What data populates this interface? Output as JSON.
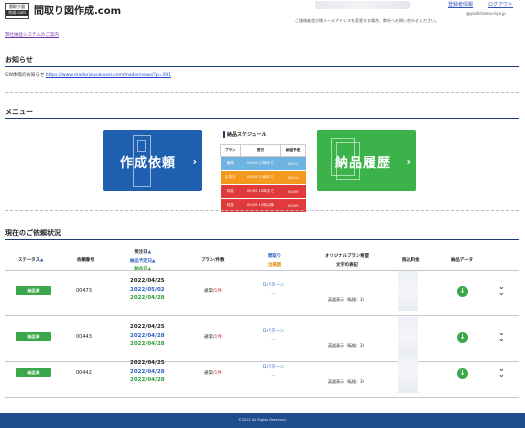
{
  "header": {
    "logo_line1": "間取り図",
    "logo_line2": "作成.com",
    "site_title": "間取り図作成.com",
    "link_register": "登録者情報",
    "link_logout": "ログアウト",
    "note_email": "@yoshihama-riya.jp",
    "note_change": "ご連絡者並び様メールアドレスを変更する場合、弊社へお問い合わせください。",
    "system_link": "弊社納品システムのご案内"
  },
  "news": {
    "title": "お知らせ",
    "text": "GW休暇のお知らせ",
    "link": "https://www.madorizusakusei.com/madorinews/?p=391"
  },
  "menu": {
    "title": "メニュー",
    "create_label": "作成依頼",
    "history_label": "納品履歴",
    "arrow": "›",
    "schedule": {
      "title": "納品スケジュール",
      "headers": [
        "プラン",
        "受付",
        "納品予定"
      ],
      "rows": [
        {
          "plan": "通常",
          "accept": "05/09 12時まで",
          "due": "05/12",
          "color": "#6fb3e0"
        },
        {
          "plan": "お急ぎ",
          "accept": "05/09 12時まで",
          "due": "05/10",
          "color": "#f39a1e"
        },
        {
          "plan": "特急",
          "accept": "05/09 12時まで",
          "due": "05/09",
          "color": "#e03a3a"
        },
        {
          "plan": "特急",
          "accept": "05/09 12時以降",
          "due": "05/09",
          "color": "#e03a3a"
        }
      ]
    }
  },
  "requests": {
    "title": "現在のご依頼状況",
    "headers": {
      "status": "ステータス",
      "sort_asc": "▲",
      "request_no": "依頼番号",
      "date_requested": "受注日",
      "date_due": "納品予定日",
      "date_delivered": "納品日",
      "plan_count": "プラン/件数",
      "floor": "間取り",
      "sub": "出展図",
      "original": "オリジナルプラン希望",
      "original2": "文字の表記",
      "price": "税込料金",
      "download": "納品データ"
    },
    "rows": [
      {
        "status": "納品済",
        "no": "00473",
        "d1": "2022/04/25",
        "d2": "2022/05/02",
        "d3": "2022/04/28",
        "plan": "通常",
        "count": "1件",
        "pattern": "Dパターン",
        "dash": "—",
        "original": "英語表示（転換：3）"
      },
      {
        "status": "納品済",
        "no": "00443",
        "d1": "2022/04/25",
        "d2": "2022/04/28",
        "d3": "2022/04/28",
        "plan": "通常",
        "count": "1件",
        "pattern": "Dパターン",
        "dash": "—",
        "original": "英語表示（転換：3）"
      },
      {
        "status": "納品済",
        "no": "00442",
        "d1": "2022/04/25",
        "d2": "2022/04/28",
        "d3": "2022/04/28",
        "plan": "通常",
        "count": "1件",
        "pattern": "Dパターン",
        "dash": "—",
        "original": "英語表示（転換：3）"
      }
    ],
    "download_icon": "download-icon",
    "expand_icon": "chevron-double-down-icon"
  },
  "footer": {
    "copyright": "©2022 All Rights Reserved."
  }
}
